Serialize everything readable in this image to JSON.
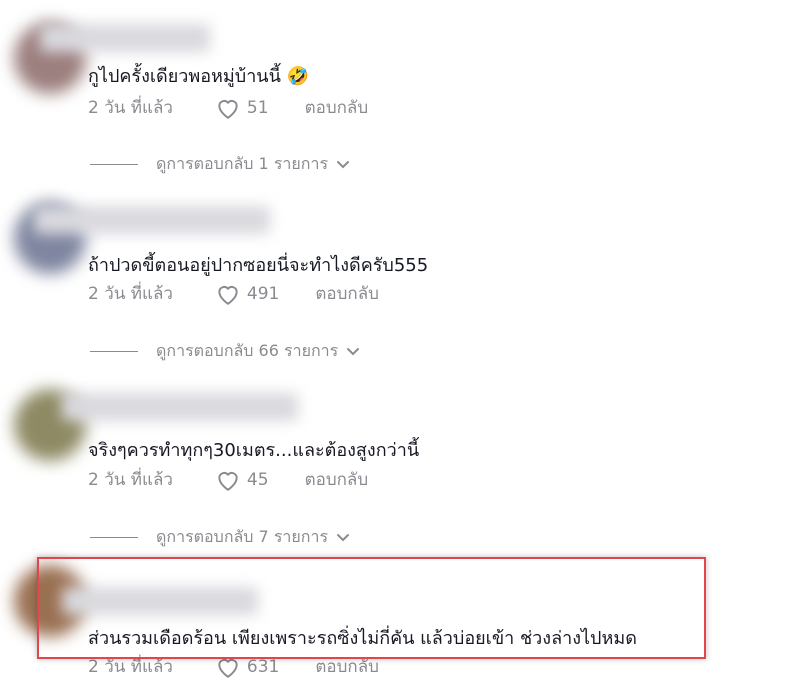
{
  "comments": [
    {
      "text": "กูไปครั้งเดียวพอหมู่บ้านนี้ 🤣",
      "time": "2 วัน ที่แล้ว",
      "likes": "51",
      "reply": "ตอบกลับ",
      "view_replies": "ดูการตอบกลับ 1 รายการ"
    },
    {
      "text": "ถ้าปวดขี้ตอนอยู่ปากซอยนี่จะทำไงดีครับ555",
      "time": "2 วัน ที่แล้ว",
      "likes": "491",
      "reply": "ตอบกลับ",
      "view_replies": "ดูการตอบกลับ 66 รายการ"
    },
    {
      "text": "จริงๆควรทำทุกๆ30เมตร...และต้องสูงกว่านี้",
      "time": "2 วัน ที่แล้ว",
      "likes": "45",
      "reply": "ตอบกลับ",
      "view_replies": "ดูการตอบกลับ 7 รายการ"
    },
    {
      "text": "ส่วนรวมเดือดร้อน เพียงเพราะรถซิ่งไม่กี่คัน แล้วบ่อยเข้า ช่วงล่างไปหมด",
      "time": "2 วัน ที่แล้ว",
      "likes": "631",
      "reply": "ตอบกลับ"
    }
  ],
  "icons": {
    "like": "heart-outline-icon",
    "expand": "chevron-down-icon"
  },
  "colors": {
    "text": "#161823",
    "meta": "#8a8b91",
    "highlight": "#e2454c"
  }
}
